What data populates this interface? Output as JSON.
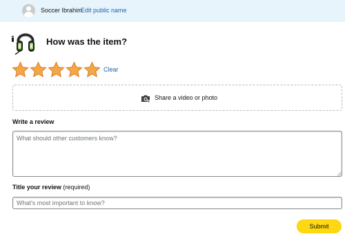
{
  "header": {
    "user_name": "Soccer Ibrahim",
    "edit_link": "Edit public name"
  },
  "product": {
    "image": "gaming-headset-image",
    "question": "How was the item?"
  },
  "rating": {
    "stars_selected": 5,
    "stars_total": 5,
    "star_color": "#f3a847",
    "clear_label": "Clear"
  },
  "media": {
    "icon": "camera-icon",
    "label": "Share a video or photo"
  },
  "review": {
    "label": "Write a review",
    "placeholder": "What should other customers know?"
  },
  "title": {
    "label": "Title your review",
    "required_note": "(required)",
    "placeholder": "What's most important to know?"
  },
  "submit": {
    "label": "Submit",
    "color": "#ffd814"
  }
}
